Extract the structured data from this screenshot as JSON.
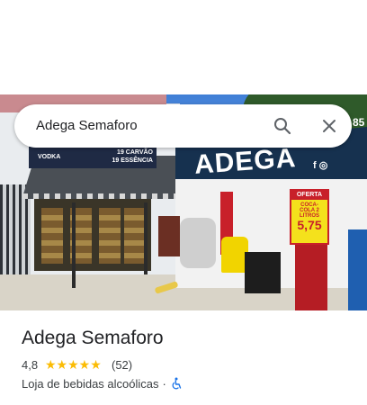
{
  "search": {
    "query": "Adega Semaforo"
  },
  "photo": {
    "sign_left": "VODKA",
    "sign_right_top": "19 CARVÃO",
    "sign_right_bottom": "19 ESSÊNCIA",
    "storefront_text": "ADEGA",
    "social_text": "f ◎",
    "corner_number": "85",
    "offer_header": "OFERTA",
    "offer_product": "COCA-COLA 2 LITROS",
    "offer_price": "5,75"
  },
  "place": {
    "name": "Adega Semaforo",
    "rating": "4,8",
    "stars": "★★★★★",
    "review_count": "(52)",
    "category": "Loja de bebidas alcoólicas",
    "separator": "·"
  },
  "colors": {
    "star": "#fbbc04",
    "accessibility_icon": "#1a73e8"
  }
}
